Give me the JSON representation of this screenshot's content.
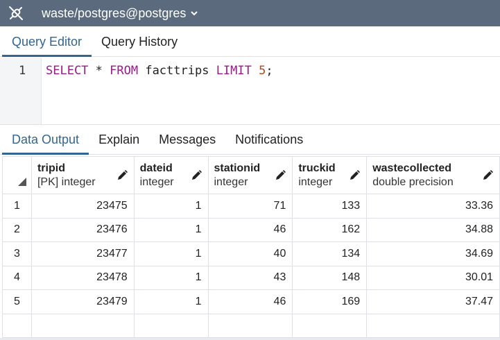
{
  "titlebar": {
    "connection": "waste/postgres@postgres"
  },
  "query_tabs": [
    {
      "label": "Query Editor",
      "active": true
    },
    {
      "label": "Query History",
      "active": false
    }
  ],
  "editor": {
    "line_number": "1",
    "kw1": "SELECT",
    "star": " * ",
    "kw2": "FROM",
    "table": " facttrips ",
    "kw3": "LIMIT",
    "space": " ",
    "limit": "5",
    "semi": ";"
  },
  "output_tabs": [
    {
      "label": "Data Output",
      "active": true
    },
    {
      "label": "Explain",
      "active": false
    },
    {
      "label": "Messages",
      "active": false
    },
    {
      "label": "Notifications",
      "active": false
    }
  ],
  "grid": {
    "columns": [
      {
        "name": "tripid",
        "type": "[PK] integer"
      },
      {
        "name": "dateid",
        "type": "integer"
      },
      {
        "name": "stationid",
        "type": "integer"
      },
      {
        "name": "truckid",
        "type": "integer"
      },
      {
        "name": "wastecollected",
        "type": "double precision"
      }
    ],
    "rows": [
      {
        "n": "1",
        "cells": [
          "23475",
          "1",
          "71",
          "133",
          "33.36"
        ]
      },
      {
        "n": "2",
        "cells": [
          "23476",
          "1",
          "46",
          "162",
          "34.88"
        ]
      },
      {
        "n": "3",
        "cells": [
          "23477",
          "1",
          "40",
          "134",
          "34.69"
        ]
      },
      {
        "n": "4",
        "cells": [
          "23478",
          "1",
          "43",
          "148",
          "30.01"
        ]
      },
      {
        "n": "5",
        "cells": [
          "23479",
          "1",
          "46",
          "169",
          "37.47"
        ]
      }
    ]
  },
  "colors": {
    "titlebar_bg": "#5b6b7d",
    "accent": "#326690",
    "keyword": "#a0168c",
    "number": "#b5491a"
  }
}
